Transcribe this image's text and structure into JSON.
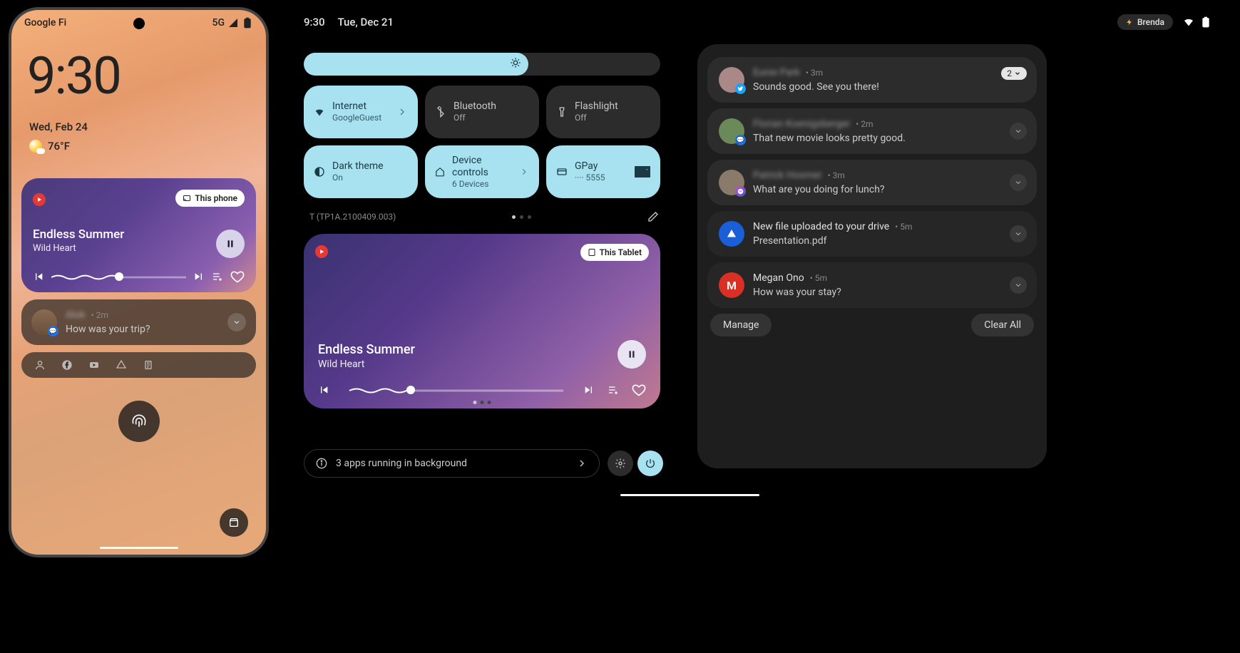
{
  "phone": {
    "carrier": "Google Fi",
    "network": "5G",
    "clock": "9:30",
    "date": "Wed, Feb 24",
    "temperature": "76°F",
    "media": {
      "castLabel": "This phone",
      "title": "Endless Summer",
      "artist": "Wild Heart"
    },
    "notification": {
      "sender": "Alok",
      "time": "2m",
      "message": "How was your trip?"
    }
  },
  "tablet": {
    "clock": "9:30",
    "date": "Tue, Dec 21",
    "user": "Brenda",
    "buildId": "T (TP1A.2100409.003)",
    "tiles": [
      {
        "title": "Internet",
        "subtitle": "GoogleGuest",
        "active": true,
        "hasChevron": true,
        "icon": "wifi"
      },
      {
        "title": "Bluetooth",
        "subtitle": "Off",
        "active": false,
        "icon": "bluetooth"
      },
      {
        "title": "Flashlight",
        "subtitle": "Off",
        "active": false,
        "icon": "flashlight"
      },
      {
        "title": "Dark theme",
        "subtitle": "On",
        "active": true,
        "icon": "darktheme"
      },
      {
        "title": "Device controls",
        "subtitle": "6 Devices",
        "active": true,
        "hasChevron": true,
        "icon": "home"
      },
      {
        "title": "GPay",
        "subtitle": "···· 5555",
        "active": true,
        "icon": "card"
      }
    ],
    "media": {
      "castLabel": "This Tablet",
      "title": "Endless Summer",
      "artist": "Wild Heart"
    },
    "backgroundApps": "3 apps running in background",
    "notifications": [
      {
        "sender": "Eunie Park",
        "time": "3m",
        "message": "Sounds good. See you there!",
        "count": "2",
        "badge": "twitter",
        "blurSender": true
      },
      {
        "sender": "Florian Koenigsberger",
        "time": "2m",
        "message": "That new movie looks pretty good.",
        "badge": "messages",
        "blurSender": true
      },
      {
        "sender": "Patrick Hosmer",
        "time": "3m",
        "message": "What are you doing for lunch?",
        "badge": "messenger",
        "blurSender": true
      },
      {
        "sender": "New file uploaded to your drive",
        "time": "5m",
        "message": "Presentation.pdf",
        "badge": "drive"
      },
      {
        "sender": "Megan Ono",
        "time": "5m",
        "message": "How was your stay?",
        "badge": "gmail"
      }
    ],
    "manageLabel": "Manage",
    "clearAllLabel": "Clear All"
  }
}
